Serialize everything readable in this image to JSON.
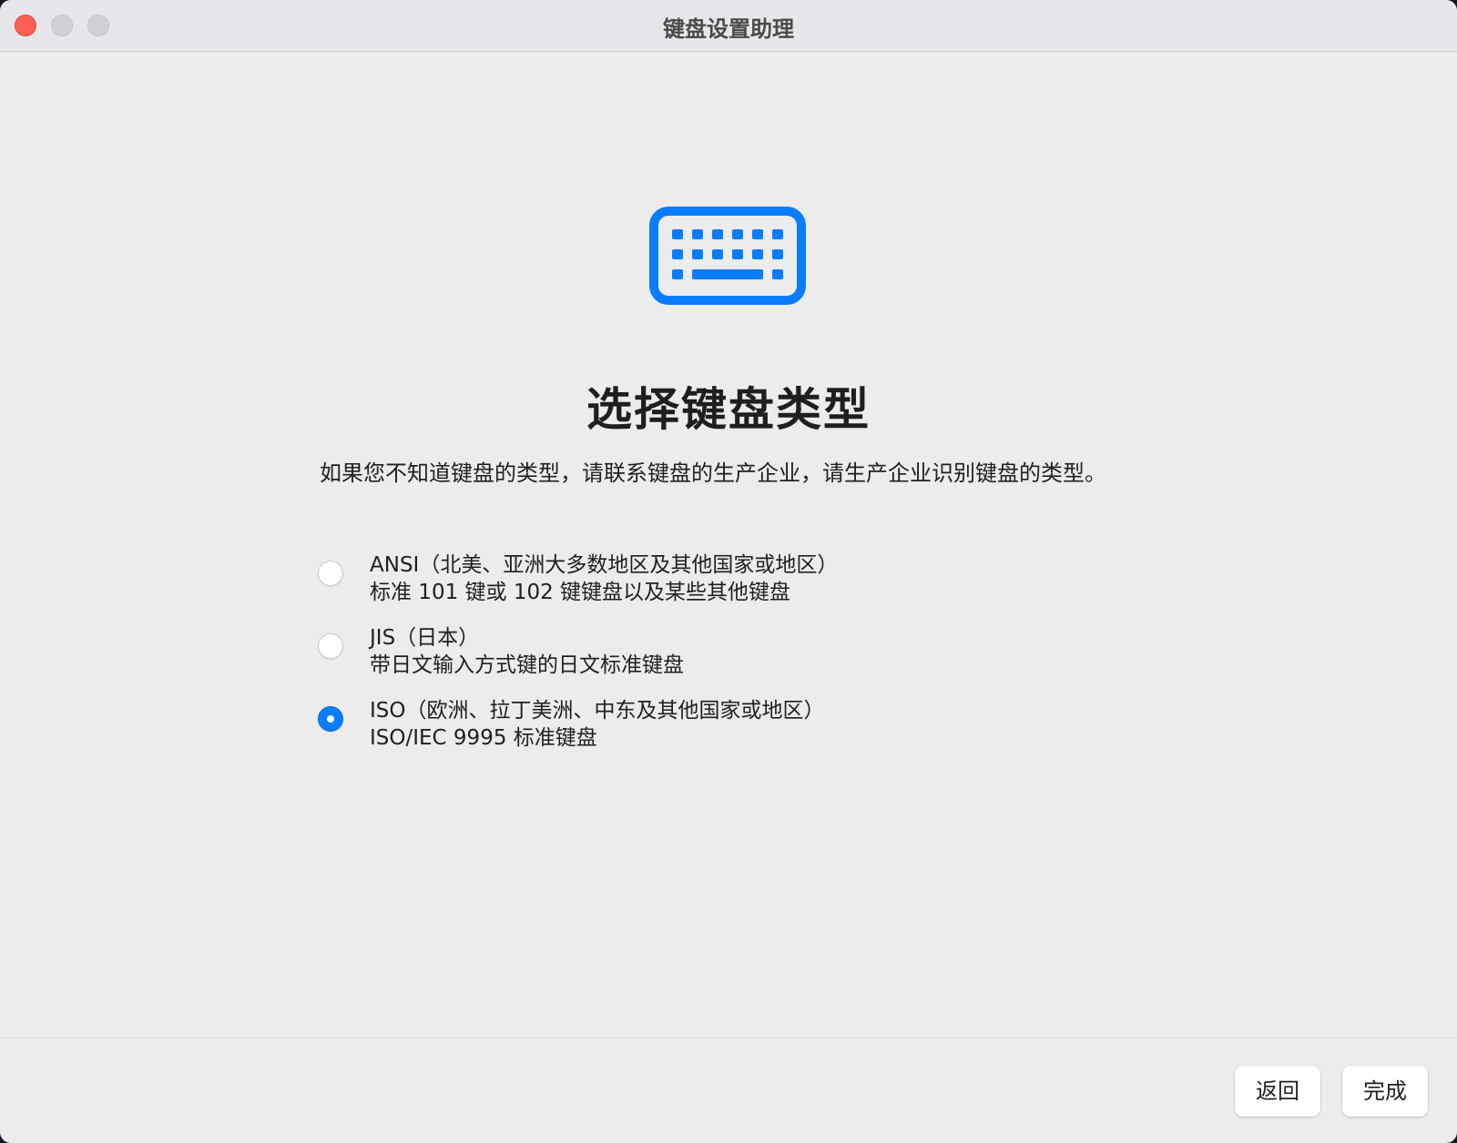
{
  "window": {
    "title": "键盘设置助理"
  },
  "hero_icon": "keyboard-icon",
  "heading": "选择键盘类型",
  "description": "如果您不知道键盘的类型，请联系键盘的生产企业，请生产企业识别键盘的类型。",
  "options": [
    {
      "title": "ANSI（北美、亚洲大多数地区及其他国家或地区）",
      "subtitle": "标准 101 键或 102 键键盘以及某些其他键盘",
      "selected": false
    },
    {
      "title": "JIS（日本）",
      "subtitle": "带日文输入方式键的日文标准键盘",
      "selected": false
    },
    {
      "title": "ISO（欧洲、拉丁美洲、中东及其他国家或地区）",
      "subtitle": "ISO/IEC 9995 标准键盘",
      "selected": true
    }
  ],
  "buttons": {
    "back_label": "返回",
    "done_label": "完成"
  },
  "colors": {
    "accent": "#0a7cff",
    "close": "#fe5f57",
    "window_bg": "#ececec"
  }
}
